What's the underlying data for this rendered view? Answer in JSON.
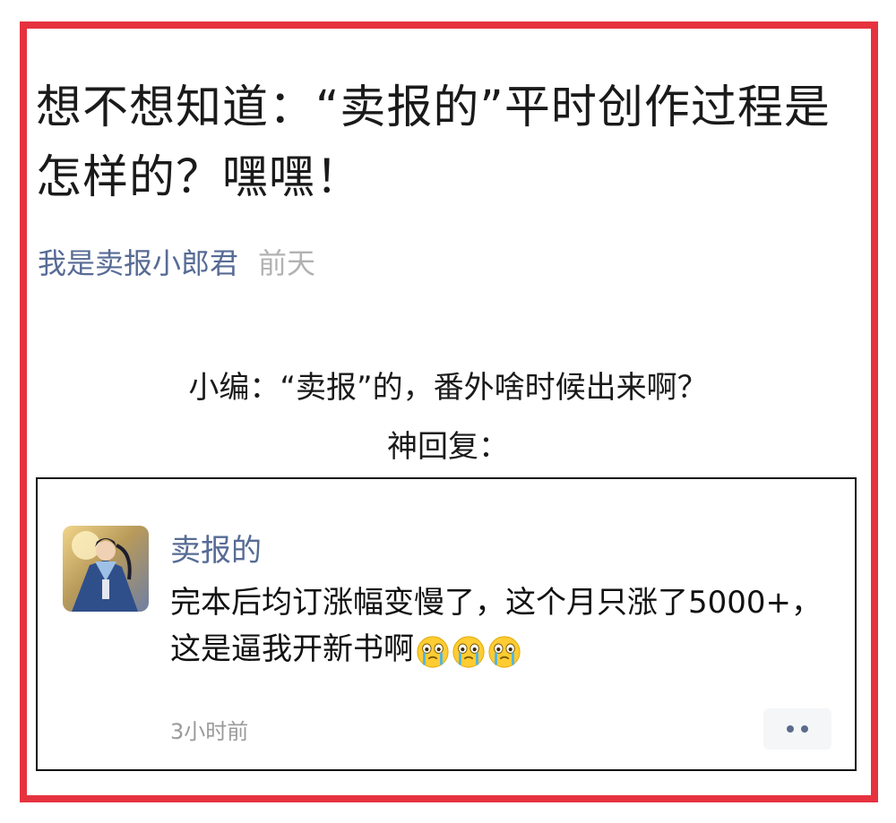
{
  "article": {
    "title": "想不想知道：“卖报的”平时创作过程是怎样的？嘿嘿！",
    "author": "我是卖报小郎君",
    "time": "前天"
  },
  "content": {
    "line1": "小编：“卖报”的，番外啥时候出来啊？",
    "line2": "神回复："
  },
  "comment": {
    "username": "卖报的",
    "text": "完本后均订涨幅变慢了，这个月只涨了5000+，这是逼我开新书啊",
    "emoji": "crying-face-icon",
    "emoji_count": 3,
    "time": "3小时前",
    "more_icon": "more-dots-icon"
  },
  "colors": {
    "frame": "#e6323f",
    "link": "#576b95",
    "muted": "#b2b2b2"
  }
}
